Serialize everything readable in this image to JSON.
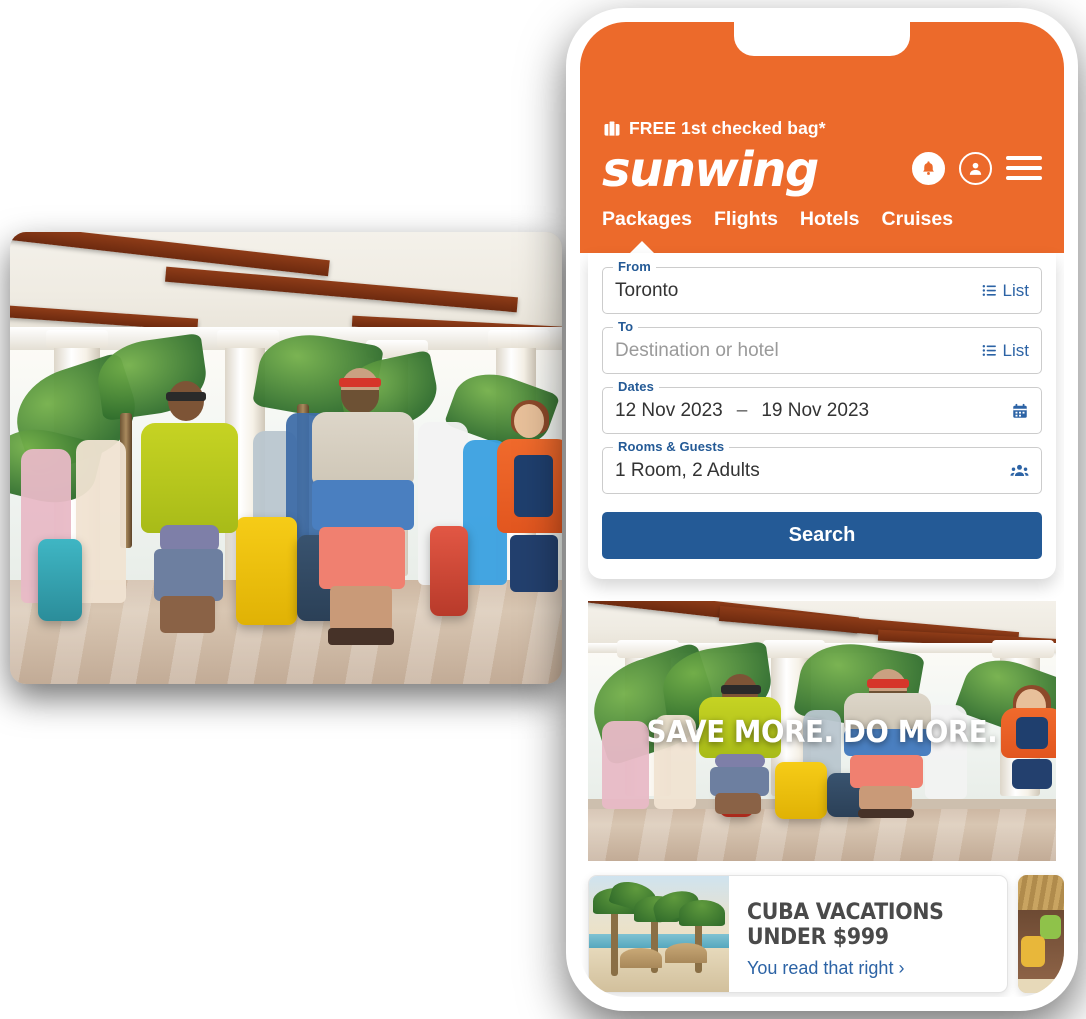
{
  "brand": {
    "name": "sunwing",
    "orange": "#ec6a2b",
    "blue": "#245a96"
  },
  "header": {
    "promo_banner": "FREE 1st checked bag*",
    "suitcase_icon": "suitcase-icon",
    "notification_icon": "bell-icon",
    "account_icon": "user-icon",
    "menu_icon": "hamburger-menu-icon",
    "tabs": [
      {
        "label": "Packages",
        "active": true
      },
      {
        "label": "Flights",
        "active": false
      },
      {
        "label": "Hotels",
        "active": false
      },
      {
        "label": "Cruises",
        "active": false
      }
    ]
  },
  "search_form": {
    "from": {
      "label": "From",
      "value": "Toronto",
      "action_label": "List",
      "action_icon": "list-icon"
    },
    "to": {
      "label": "To",
      "placeholder": "Destination or hotel",
      "action_label": "List",
      "action_icon": "list-icon"
    },
    "dates": {
      "label": "Dates",
      "start": "12 Nov 2023",
      "separator": "–",
      "end": "19 Nov 2023",
      "icon": "calendar-icon"
    },
    "rooms_guests": {
      "label": "Rooms & Guests",
      "value": "1 Room, 2 Adults",
      "icon": "guests-icon"
    },
    "submit_label": "Search"
  },
  "hero": {
    "headline": "SAVE MORE. DO MORE."
  },
  "promos": [
    {
      "title": "CUBA VACATIONS UNDER $999",
      "link_text": "You read that right ›"
    }
  ]
}
